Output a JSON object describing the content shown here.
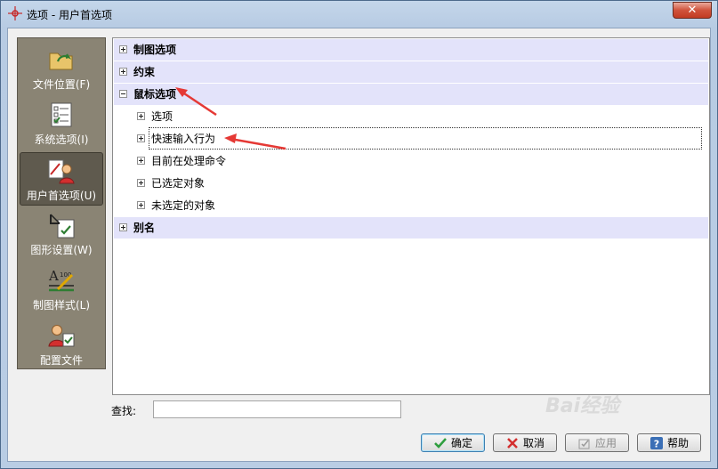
{
  "window": {
    "title": "选项 - 用户首选项",
    "close_label": "✕"
  },
  "sidebar": {
    "items": [
      {
        "label": "文件位置(F)",
        "icon": "folder-icon",
        "selected": false
      },
      {
        "label": "系统选项(I)",
        "icon": "checklist-icon",
        "selected": false
      },
      {
        "label": "用户首选项(U)",
        "icon": "user-preferences-icon",
        "selected": true
      },
      {
        "label": "图形设置(W)",
        "icon": "graphics-settings-icon",
        "selected": false
      },
      {
        "label": "制图样式(L)",
        "icon": "drafting-style-icon",
        "selected": false
      },
      {
        "label": "配置文件",
        "icon": "profile-icon",
        "selected": false
      }
    ]
  },
  "tree": {
    "nodes": [
      {
        "label": "制图选项",
        "level": 0,
        "expanded": false
      },
      {
        "label": "约束",
        "level": 0,
        "expanded": false
      },
      {
        "label": "鼠标选项",
        "level": 0,
        "expanded": true
      },
      {
        "label": "选项",
        "level": 1,
        "expanded": false
      },
      {
        "label": "快速输入行为",
        "level": 1,
        "expanded": false,
        "focused": true
      },
      {
        "label": "目前在处理命令",
        "level": 1,
        "expanded": false
      },
      {
        "label": "已选定对象",
        "level": 1,
        "expanded": false
      },
      {
        "label": "未选定的对象",
        "level": 1,
        "expanded": false
      },
      {
        "label": "别名",
        "level": 0,
        "expanded": false
      }
    ]
  },
  "search": {
    "label": "查找:",
    "value": "",
    "placeholder": ""
  },
  "buttons": {
    "ok": "确定",
    "cancel": "取消",
    "apply": "应用",
    "help": "帮助"
  },
  "watermark": "Bai经验",
  "colors": {
    "sidebar_bg": "#8a8474",
    "tree_band": "#e3e3fa",
    "annotation_arrow": "#e53935"
  }
}
